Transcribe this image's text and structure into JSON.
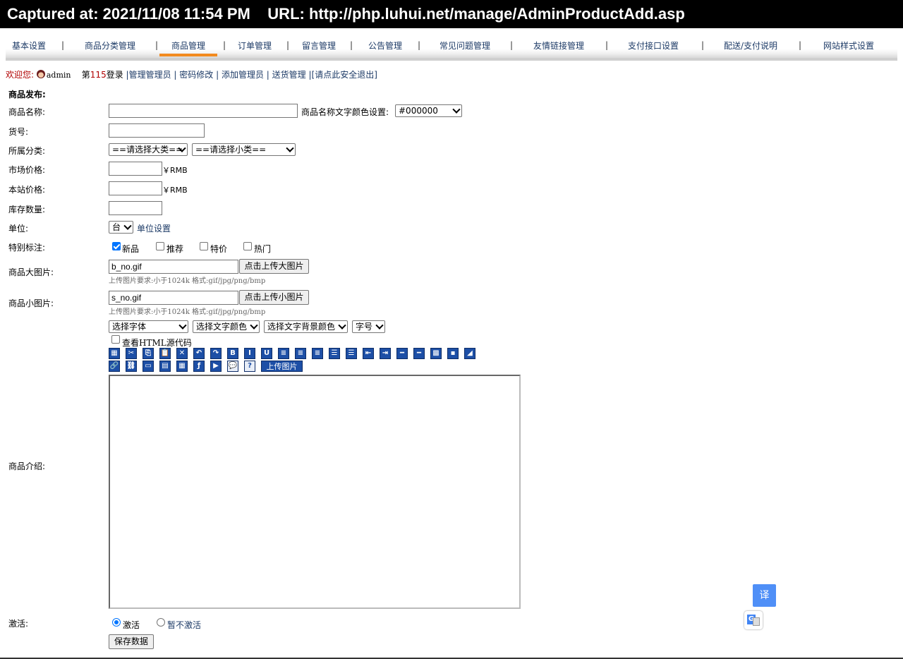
{
  "capture": {
    "text": "Captured at: 2021/11/08 11:54 PM    URL: http://php.luhui.net/manage/AdminProductAdd.asp"
  },
  "nav": {
    "items": [
      "基本设置",
      "商品分类管理",
      "商品管理",
      "订单管理",
      "留言管理",
      "公告管理",
      "常见问题管理",
      "友情链接管理",
      "支付接口设置",
      "配送/支付说明",
      "网站样式设置"
    ],
    "separator": "|",
    "active_index": 2,
    "active_color": "#f28a1f"
  },
  "welcome": {
    "greeting": "欢迎您:",
    "user": "admin",
    "login_prefix": "第",
    "login_count": "115",
    "login_suffix": "登录",
    "links": [
      "|管理管理员",
      "| 密码修改",
      "| 添加管理员",
      "| 送货管理",
      "|[请点此安全退出]"
    ]
  },
  "form": {
    "section_title": "商品发布:",
    "name_label": "商品名称:",
    "name_value": "",
    "color_label": "商品名称文字颜色设置:",
    "color_value": "#000000",
    "sku_label": "货号:",
    "category_label": "所属分类:",
    "category_big": "==请选择大类==",
    "category_small": "==请选择小类==",
    "market_price_label": "市场价格:",
    "site_price_label": "本站价格:",
    "currency": "￥RMB",
    "stock_label": "库存数量:",
    "unit_label": "单位:",
    "unit_value": "台",
    "unit_setting": "单位设置",
    "flags_label": "特别标注:",
    "flags": [
      {
        "label": "新品",
        "checked": true
      },
      {
        "label": "推荐",
        "checked": false
      },
      {
        "label": "特价",
        "checked": false
      },
      {
        "label": "热门",
        "checked": false
      }
    ],
    "big_image_label": "商品大图片:",
    "big_image_value": "b_no.gif",
    "big_image_button": "点击上传大图片",
    "small_image_label": "商品小图片:",
    "small_image_value": "s_no.gif",
    "small_image_button": "点击上传小图片",
    "image_hint": "上传图片要求:小于1024k 格式:gif/jpg/png/bmp",
    "intro_label": "商品介绍:",
    "editor": {
      "font_select": "选择字体",
      "text_color_select": "选择文字颜色",
      "bg_color_select": "选择文字背景颜色",
      "size_select": "字号",
      "html_source": "查看HTML源代码",
      "upload_image": "上传图片",
      "toolbar_row1": [
        "select-all-icon",
        "cut-icon",
        "copy-icon",
        "paste-icon",
        "delete-icon",
        "undo-icon",
        "redo-icon",
        "bold-icon",
        "italic-icon",
        "underline-icon",
        "align-left-icon",
        "align-center-icon",
        "align-right-icon",
        "ordered-list-icon",
        "unordered-list-icon",
        "outdent-icon",
        "indent-icon",
        "horizontal-rule-icon",
        "remove-format-icon",
        "insert-table-icon",
        "background-icon",
        "clear-icon"
      ],
      "toolbar_row1_glyphs": [
        "▦",
        "✂",
        "⎘",
        "📋",
        "✕",
        "↶",
        "↷",
        "B",
        "I",
        "U",
        "≡",
        "≡",
        "≡",
        "☰",
        "☰",
        "⇤",
        "⇥",
        "━",
        "━",
        "▩",
        "▪",
        "◢"
      ],
      "toolbar_row2": [
        "link-icon",
        "unlink-icon",
        "marquee-icon",
        "note-icon",
        "table-icon",
        "flash-icon",
        "media-icon",
        "comment-icon",
        "help-icon"
      ],
      "toolbar_row2_glyphs": [
        "🔗",
        "⛓",
        "▭",
        "▤",
        "▦",
        "ƒ",
        "▶",
        "💬",
        "?"
      ]
    },
    "active_label": "激活:",
    "active_options": [
      {
        "label": "激活",
        "checked": true
      },
      {
        "label": "暂不激活",
        "checked": false
      }
    ],
    "save_button": "保存数据"
  },
  "overlay": {
    "translate_button": "译"
  }
}
